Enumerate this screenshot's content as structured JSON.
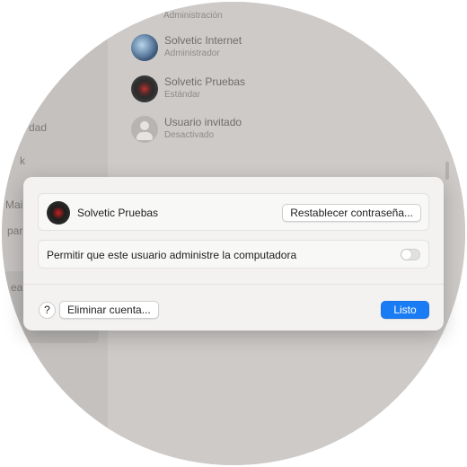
{
  "sidebar": {
    "fragments": [
      "dad",
      "k",
      "Mail",
      "para",
      "ea"
    ]
  },
  "background_users": {
    "caption": "Administración",
    "users": [
      {
        "name": "Solvetic Internet",
        "role": "Administrador",
        "avatar": "globe-avatar"
      },
      {
        "name": "Solvetic Pruebas",
        "role": "Estándar",
        "avatar": "record-avatar"
      },
      {
        "name": "Usuario invitado",
        "role": "Desactivado",
        "avatar": "guest-avatar"
      }
    ]
  },
  "dialog": {
    "user": {
      "name": "Solvetic Pruebas",
      "avatar": "record-avatar"
    },
    "reset_password_label": "Restablecer contraseña...",
    "admin_permission_label": "Permitir que este usuario administre la computadora",
    "admin_permission_enabled": false,
    "help_label": "?",
    "delete_account_label": "Eliminar cuenta...",
    "done_label": "Listo",
    "colors": {
      "accent": "#1a7cf4",
      "dialog_bg": "#f3f2f1"
    }
  }
}
